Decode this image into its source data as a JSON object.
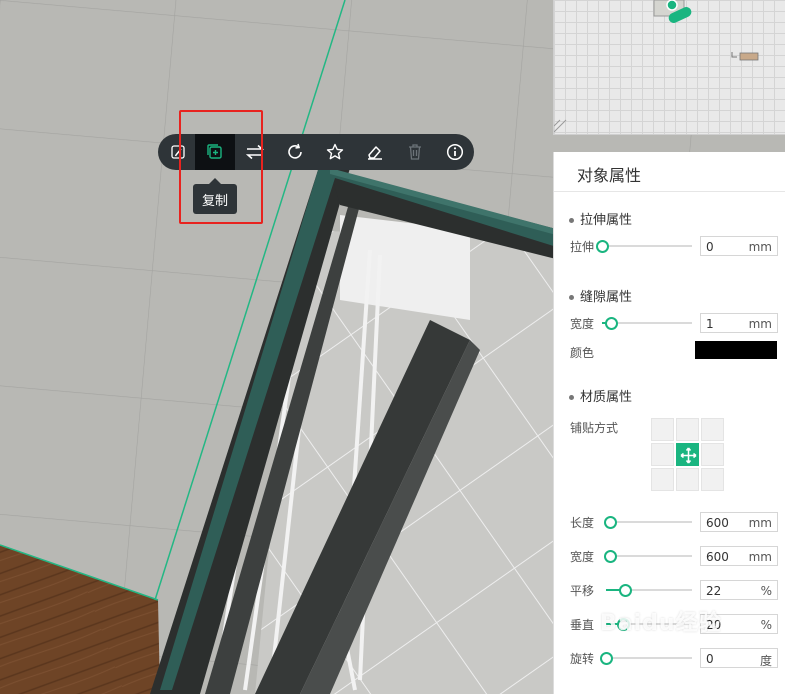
{
  "toolbar": {
    "items": [
      {
        "name": "edit",
        "icon": "pencil-icon"
      },
      {
        "name": "copy",
        "icon": "copy-icon",
        "active": true
      },
      {
        "name": "flip",
        "icon": "swap-arrows-icon"
      },
      {
        "name": "rotate",
        "icon": "rotate-icon"
      },
      {
        "name": "favorite",
        "icon": "star-icon"
      },
      {
        "name": "erase",
        "icon": "eraser-icon"
      },
      {
        "name": "delete",
        "icon": "trash-icon",
        "disabled": true
      },
      {
        "name": "info",
        "icon": "info-icon"
      }
    ],
    "tooltip": "复制"
  },
  "panel": {
    "title": "对象属性",
    "stretch": {
      "heading": "拉伸属性",
      "label": "拉伸",
      "value": "0",
      "unit": "mm",
      "level": 0
    },
    "gap": {
      "heading": "缝隙属性",
      "width_label": "宽度",
      "width_value": "1",
      "width_unit": "mm",
      "width_level": 0.1,
      "color_label": "颜色",
      "color": "#000000"
    },
    "material": {
      "heading": "材质属性",
      "tiling_label": "铺贴方式",
      "length_label": "长度",
      "length_value": "600",
      "length_unit": "mm",
      "length_level": 0.05,
      "width_label": "宽度",
      "width_value": "600",
      "width_unit": "mm",
      "width_level": 0.05,
      "offset_label": "平移",
      "offset_value": "22",
      "offset_unit": "%",
      "offset_level": 0.22,
      "vertical_label": "垂直",
      "vertical_value": "20",
      "vertical_unit": "%",
      "vertical_level": 0.2,
      "rotate_label": "旋转",
      "rotate_value": "0",
      "rotate_unit": "度",
      "rotate_level": 0
    }
  },
  "colors": {
    "accent": "#1ab580",
    "toolbar_bg": "#2e3438",
    "highlight": "#e8231f"
  },
  "watermark": {
    "brand": "Baidu经验",
    "url": "jingyan.baidu.com"
  }
}
